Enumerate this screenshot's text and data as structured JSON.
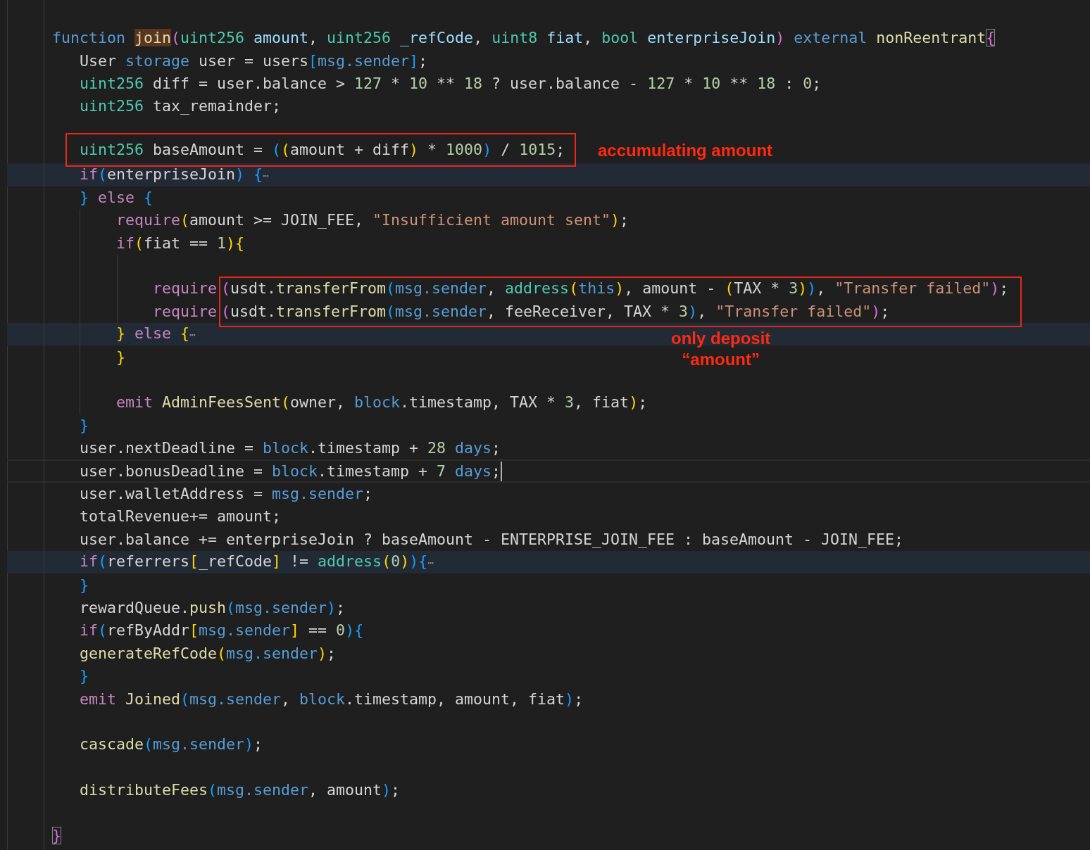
{
  "editor": {
    "lines": [
      {
        "folded": false,
        "current": false,
        "tokens": [
          {
            "kind": "st",
            "text": "function "
          },
          {
            "kind": "hl",
            "text": "join"
          },
          {
            "kind": "b2",
            "text": "("
          },
          {
            "kind": "ty",
            "text": "uint256 "
          },
          {
            "kind": "var",
            "text": "amount"
          },
          {
            "kind": "p",
            "text": ", "
          },
          {
            "kind": "ty",
            "text": "uint256 "
          },
          {
            "kind": "var",
            "text": "_refCode"
          },
          {
            "kind": "p",
            "text": ", "
          },
          {
            "kind": "ty",
            "text": "uint8 "
          },
          {
            "kind": "var",
            "text": "fiat"
          },
          {
            "kind": "p",
            "text": ", "
          },
          {
            "kind": "ty",
            "text": "bool "
          },
          {
            "kind": "var",
            "text": "enterpriseJoin"
          },
          {
            "kind": "b2",
            "text": ")"
          },
          {
            "kind": "st",
            "text": " external "
          },
          {
            "kind": "fn",
            "text": "nonReentrant"
          },
          {
            "kind": "bm",
            "text": "{"
          }
        ]
      },
      {
        "folded": false,
        "current": false,
        "tokens": [
          {
            "kind": "p",
            "text": "   User "
          },
          {
            "kind": "st",
            "text": "storage"
          },
          {
            "kind": "p",
            "text": " user = users"
          },
          {
            "kind": "b3",
            "text": "["
          },
          {
            "kind": "st",
            "text": "msg.sender"
          },
          {
            "kind": "b3",
            "text": "]"
          },
          {
            "kind": "p",
            "text": ";"
          }
        ]
      },
      {
        "folded": false,
        "current": false,
        "tokens": [
          {
            "kind": "ty",
            "text": "   uint256"
          },
          {
            "kind": "p",
            "text": " diff = user.balance > "
          },
          {
            "kind": "num",
            "text": "127"
          },
          {
            "kind": "p",
            "text": " * "
          },
          {
            "kind": "num",
            "text": "10"
          },
          {
            "kind": "p",
            "text": " ** "
          },
          {
            "kind": "num",
            "text": "18"
          },
          {
            "kind": "p",
            "text": " ? user.balance - "
          },
          {
            "kind": "num",
            "text": "127"
          },
          {
            "kind": "p",
            "text": " * "
          },
          {
            "kind": "num",
            "text": "10"
          },
          {
            "kind": "p",
            "text": " ** "
          },
          {
            "kind": "num",
            "text": "18"
          },
          {
            "kind": "p",
            "text": " : "
          },
          {
            "kind": "num",
            "text": "0"
          },
          {
            "kind": "p",
            "text": ";"
          }
        ]
      },
      {
        "folded": false,
        "current": false,
        "tokens": [
          {
            "kind": "ty",
            "text": "   uint256"
          },
          {
            "kind": "p",
            "text": " tax_remainder;"
          }
        ]
      },
      {
        "folded": false,
        "current": false
      },
      {
        "folded": false,
        "current": false,
        "tokens": [
          {
            "kind": "ty",
            "text": "   uint256"
          },
          {
            "kind": "p",
            "text": " baseAmount = "
          },
          {
            "kind": "b3",
            "text": "("
          },
          {
            "kind": "b1",
            "text": "("
          },
          {
            "kind": "p",
            "text": "amount + diff"
          },
          {
            "kind": "b1",
            "text": ")"
          },
          {
            "kind": "p",
            "text": " * "
          },
          {
            "kind": "num",
            "text": "1000"
          },
          {
            "kind": "b3",
            "text": ")"
          },
          {
            "kind": "p",
            "text": " / "
          },
          {
            "kind": "num",
            "text": "1015"
          },
          {
            "kind": "p",
            "text": ";"
          }
        ]
      },
      {
        "folded": true,
        "current": false,
        "tokens": [
          {
            "kind": "kw",
            "text": "   if"
          },
          {
            "kind": "b3",
            "text": "("
          },
          {
            "kind": "p",
            "text": "enterpriseJoin"
          },
          {
            "kind": "b3",
            "text": ")"
          },
          {
            "kind": "b3",
            "text": " {"
          },
          {
            "kind": "fold",
            "text": "⋯"
          }
        ]
      },
      {
        "folded": false,
        "current": false,
        "tokens": [
          {
            "kind": "b3",
            "text": "   }"
          },
          {
            "kind": "kw",
            "text": " else "
          },
          {
            "kind": "b3",
            "text": "{"
          }
        ]
      },
      {
        "folded": false,
        "current": false,
        "tokens": [
          {
            "kind": "kw",
            "text": "       require"
          },
          {
            "kind": "b1",
            "text": "("
          },
          {
            "kind": "p",
            "text": "amount >= JOIN_FEE, "
          },
          {
            "kind": "str",
            "text": "\"Insufficient amount sent\""
          },
          {
            "kind": "b1",
            "text": ")"
          },
          {
            "kind": "p",
            "text": ";"
          }
        ]
      },
      {
        "folded": false,
        "current": false,
        "tokens": [
          {
            "kind": "kw",
            "text": "       if"
          },
          {
            "kind": "b1",
            "text": "("
          },
          {
            "kind": "p",
            "text": "fiat == "
          },
          {
            "kind": "num",
            "text": "1"
          },
          {
            "kind": "b1",
            "text": ")"
          },
          {
            "kind": "b1",
            "text": "{"
          }
        ]
      },
      {
        "folded": false,
        "current": false
      },
      {
        "folded": false,
        "current": false,
        "tokens": [
          {
            "kind": "kw",
            "text": "           require"
          },
          {
            "kind": "gap",
            "text": "("
          },
          {
            "kind": "p",
            "text": "usdt."
          },
          {
            "kind": "fn",
            "text": "transferFrom"
          },
          {
            "kind": "b3",
            "text": "("
          },
          {
            "kind": "st",
            "text": "msg.sender"
          },
          {
            "kind": "p",
            "text": ", "
          },
          {
            "kind": "ty",
            "text": "address"
          },
          {
            "kind": "b1",
            "text": "("
          },
          {
            "kind": "st",
            "text": "this"
          },
          {
            "kind": "b1",
            "text": ")"
          },
          {
            "kind": "p",
            "text": ", amount - "
          },
          {
            "kind": "b1",
            "text": "("
          },
          {
            "kind": "p",
            "text": "TAX * "
          },
          {
            "kind": "num",
            "text": "3"
          },
          {
            "kind": "b1",
            "text": ")"
          },
          {
            "kind": "b3",
            "text": ")"
          },
          {
            "kind": "p",
            "text": ", "
          },
          {
            "kind": "str",
            "text": "\"Transfer failed\""
          },
          {
            "kind": "b2",
            "text": ")"
          },
          {
            "kind": "p",
            "text": ";"
          }
        ]
      },
      {
        "folded": false,
        "current": false,
        "tokens": [
          {
            "kind": "kw",
            "text": "           require"
          },
          {
            "kind": "gap",
            "text": "("
          },
          {
            "kind": "p",
            "text": "usdt."
          },
          {
            "kind": "fn",
            "text": "transferFrom"
          },
          {
            "kind": "b3",
            "text": "("
          },
          {
            "kind": "st",
            "text": "msg.sender"
          },
          {
            "kind": "p",
            "text": ", feeReceiver, TAX * "
          },
          {
            "kind": "num",
            "text": "3"
          },
          {
            "kind": "b3",
            "text": ")"
          },
          {
            "kind": "p",
            "text": ", "
          },
          {
            "kind": "str",
            "text": "\"Transfer failed\""
          },
          {
            "kind": "b2",
            "text": ")"
          },
          {
            "kind": "p",
            "text": ";"
          }
        ]
      },
      {
        "folded": true,
        "current": false,
        "tokens": [
          {
            "kind": "b1",
            "text": "       }"
          },
          {
            "kind": "kw",
            "text": " else "
          },
          {
            "kind": "b1",
            "text": "{"
          },
          {
            "kind": "fold",
            "text": "⋯"
          }
        ]
      },
      {
        "folded": false,
        "current": false,
        "tokens": [
          {
            "kind": "b1",
            "text": "       }"
          }
        ]
      },
      {
        "folded": false,
        "current": false
      },
      {
        "folded": false,
        "current": false,
        "tokens": [
          {
            "kind": "kw",
            "text": "       emit "
          },
          {
            "kind": "fn",
            "text": "AdminFeesSent"
          },
          {
            "kind": "b1",
            "text": "("
          },
          {
            "kind": "p",
            "text": "owner, "
          },
          {
            "kind": "st",
            "text": "block"
          },
          {
            "kind": "p",
            "text": ".timestamp, TAX * "
          },
          {
            "kind": "num",
            "text": "3"
          },
          {
            "kind": "p",
            "text": ", fiat"
          },
          {
            "kind": "b1",
            "text": ")"
          },
          {
            "kind": "p",
            "text": ";"
          }
        ]
      },
      {
        "folded": false,
        "current": false,
        "tokens": [
          {
            "kind": "b3",
            "text": "   }"
          }
        ]
      },
      {
        "folded": false,
        "current": false,
        "tokens": [
          {
            "kind": "p",
            "text": "   user.nextDeadline = "
          },
          {
            "kind": "st",
            "text": "block"
          },
          {
            "kind": "p",
            "text": ".timestamp + "
          },
          {
            "kind": "num",
            "text": "28"
          },
          {
            "kind": "st",
            "text": " days"
          },
          {
            "kind": "p",
            "text": ";"
          }
        ]
      },
      {
        "folded": false,
        "current": true,
        "tokens": [
          {
            "kind": "p",
            "text": "   user.bonusDeadline = "
          },
          {
            "kind": "st",
            "text": "block"
          },
          {
            "kind": "p",
            "text": ".timestamp + "
          },
          {
            "kind": "num",
            "text": "7"
          },
          {
            "kind": "st",
            "text": " days"
          },
          {
            "kind": "p",
            "text": ";"
          }
        ]
      },
      {
        "folded": false,
        "current": false,
        "tokens": [
          {
            "kind": "p",
            "text": "   user.walletAddress = "
          },
          {
            "kind": "st",
            "text": "msg.sender"
          },
          {
            "kind": "p",
            "text": ";"
          }
        ]
      },
      {
        "folded": false,
        "current": false,
        "tokens": [
          {
            "kind": "p",
            "text": "   totalRevenue+= amount;"
          }
        ]
      },
      {
        "folded": false,
        "current": false,
        "tokens": [
          {
            "kind": "p",
            "text": "   user.balance += enterpriseJoin ? baseAmount - ENTERPRISE_JOIN_FEE : baseAmount - JOIN_FEE;"
          }
        ]
      },
      {
        "folded": true,
        "current": false,
        "tokens": [
          {
            "kind": "kw",
            "text": "   if"
          },
          {
            "kind": "b3",
            "text": "("
          },
          {
            "kind": "p",
            "text": "referrers"
          },
          {
            "kind": "b1",
            "text": "["
          },
          {
            "kind": "p",
            "text": "_refCode"
          },
          {
            "kind": "b1",
            "text": "]"
          },
          {
            "kind": "p",
            "text": " != "
          },
          {
            "kind": "ty",
            "text": "address"
          },
          {
            "kind": "b1",
            "text": "("
          },
          {
            "kind": "num",
            "text": "0"
          },
          {
            "kind": "b1",
            "text": ")"
          },
          {
            "kind": "b3",
            "text": ")"
          },
          {
            "kind": "b3",
            "text": "{"
          },
          {
            "kind": "fold",
            "text": "⋯"
          }
        ]
      },
      {
        "folded": false,
        "current": false,
        "tokens": [
          {
            "kind": "b3",
            "text": "   }"
          }
        ]
      },
      {
        "folded": false,
        "current": false,
        "tokens": [
          {
            "kind": "p",
            "text": "   rewardQueue."
          },
          {
            "kind": "fn",
            "text": "push"
          },
          {
            "kind": "b3",
            "text": "("
          },
          {
            "kind": "st",
            "text": "msg.sender"
          },
          {
            "kind": "b3",
            "text": ")"
          },
          {
            "kind": "p",
            "text": ";"
          }
        ]
      },
      {
        "folded": false,
        "current": false,
        "tokens": [
          {
            "kind": "kw",
            "text": "   if"
          },
          {
            "kind": "b3",
            "text": "("
          },
          {
            "kind": "p",
            "text": "refByAddr"
          },
          {
            "kind": "b1",
            "text": "["
          },
          {
            "kind": "st",
            "text": "msg.sender"
          },
          {
            "kind": "b1",
            "text": "]"
          },
          {
            "kind": "p",
            "text": " == "
          },
          {
            "kind": "num",
            "text": "0"
          },
          {
            "kind": "b3",
            "text": ")"
          },
          {
            "kind": "b3",
            "text": "{"
          }
        ]
      },
      {
        "folded": false,
        "current": false,
        "tokens": [
          {
            "kind": "fn",
            "text": "   generateRefCode"
          },
          {
            "kind": "b1",
            "text": "("
          },
          {
            "kind": "st",
            "text": "msg.sender"
          },
          {
            "kind": "b1",
            "text": ")"
          },
          {
            "kind": "p",
            "text": ";"
          }
        ]
      },
      {
        "folded": false,
        "current": false,
        "tokens": [
          {
            "kind": "b3",
            "text": "   }"
          }
        ]
      },
      {
        "folded": false,
        "current": false,
        "tokens": [
          {
            "kind": "kw",
            "text": "   emit "
          },
          {
            "kind": "fn",
            "text": "Joined"
          },
          {
            "kind": "b3",
            "text": "("
          },
          {
            "kind": "st",
            "text": "msg.sender"
          },
          {
            "kind": "p",
            "text": ", "
          },
          {
            "kind": "st",
            "text": "block"
          },
          {
            "kind": "p",
            "text": ".timestamp, amount, fiat"
          },
          {
            "kind": "b3",
            "text": ")"
          },
          {
            "kind": "p",
            "text": ";"
          }
        ]
      },
      {
        "folded": false,
        "current": false
      },
      {
        "folded": false,
        "current": false,
        "tokens": [
          {
            "kind": "fn",
            "text": "   cascade"
          },
          {
            "kind": "b3",
            "text": "("
          },
          {
            "kind": "st",
            "text": "msg.sender"
          },
          {
            "kind": "b3",
            "text": ")"
          },
          {
            "kind": "p",
            "text": ";"
          }
        ]
      },
      {
        "folded": false,
        "current": false
      },
      {
        "folded": false,
        "current": false,
        "tokens": [
          {
            "kind": "fn",
            "text": "   distributeFees"
          },
          {
            "kind": "b3",
            "text": "("
          },
          {
            "kind": "st",
            "text": "msg.sender"
          },
          {
            "kind": "p",
            "text": ", amount"
          },
          {
            "kind": "b3",
            "text": ")"
          },
          {
            "kind": "p",
            "text": ";"
          }
        ]
      },
      {
        "folded": false,
        "current": false
      },
      {
        "folded": false,
        "current": false,
        "tokens": [
          {
            "kind": "bm",
            "text": "}"
          }
        ]
      }
    ]
  },
  "annotations": [
    {
      "lines": [
        "accumulating amount"
      ]
    },
    {
      "lines": [
        "only deposit",
        "“amount”"
      ]
    }
  ]
}
